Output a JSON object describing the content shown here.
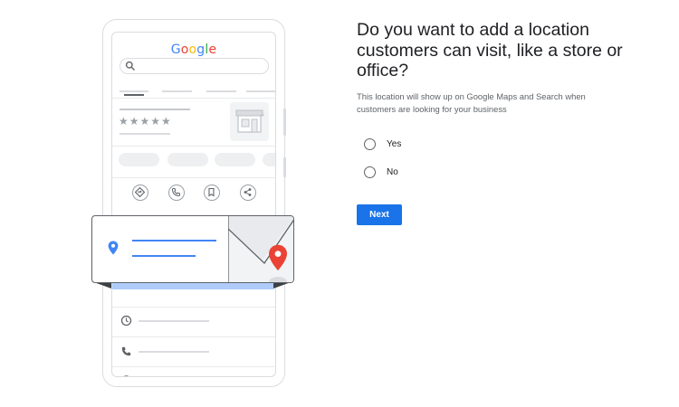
{
  "illustration": {
    "logo_text": "Google",
    "logo_colors": [
      "#4285F4",
      "#EA4335",
      "#FBBC05",
      "#4285F4",
      "#34A853",
      "#EA4335"
    ],
    "stars": "★★★★★",
    "icons": {
      "search": "search-icon",
      "directions": "directions-icon",
      "call": "phone-icon",
      "save": "bookmark-icon",
      "share": "share-icon",
      "hours": "clock-icon",
      "phone": "phone-icon",
      "website": "globe-icon",
      "location": "location-pin-icon",
      "map_pin": "map-pin-icon",
      "store": "store-icon"
    },
    "pin_color": "#EA4335",
    "accent_color": "#4285F4"
  },
  "question": {
    "title": "Do you want to add a location customers can visit, like a store or office?",
    "subtitle": "This location will show up on Google Maps and Search when customers are looking for your business"
  },
  "options": [
    {
      "label": "Yes",
      "selected": false
    },
    {
      "label": "No",
      "selected": false
    }
  ],
  "next_button": {
    "label": "Next",
    "color": "#1A73E8"
  }
}
